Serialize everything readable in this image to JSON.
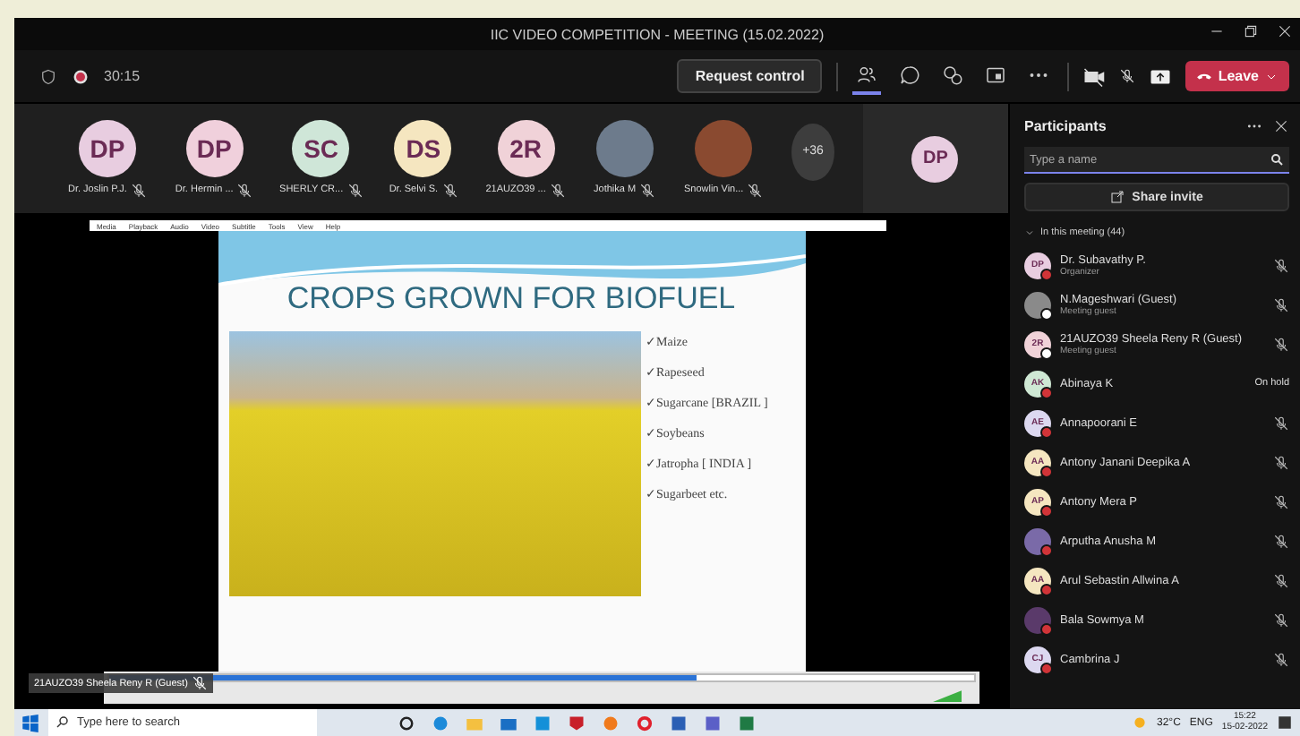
{
  "window": {
    "title": "IIC VIDEO COMPETITION - MEETING (15.02.2022)"
  },
  "toolbar": {
    "recording": true,
    "timer": "30:15",
    "request_button": "Request control",
    "leave_button": "Leave",
    "tools": [
      {
        "kind": "people",
        "selected": true
      },
      {
        "kind": "chat",
        "selected": false
      },
      {
        "kind": "reactions",
        "selected": false
      },
      {
        "kind": "rooms",
        "selected": false
      },
      {
        "kind": "more",
        "selected": false
      }
    ]
  },
  "strip": {
    "participants": [
      {
        "initials": "DP",
        "name": "Dr. Joslin P.J.",
        "color": "#e8cde0"
      },
      {
        "initials": "DP",
        "name": "Dr. Hermin ...",
        "color": "#f0d0dc"
      },
      {
        "initials": "SC",
        "name": "SHERLY CR...",
        "color": "#cfe6d8"
      },
      {
        "initials": "DS",
        "name": "Dr. Selvi S.",
        "color": "#f5e6c0"
      },
      {
        "initials": "2R",
        "name": "21AUZO39 ...",
        "color": "#f0d2d8"
      },
      {
        "name": "Jothika M",
        "color": "#6d7b8c"
      },
      {
        "name": "Snowlin Vin...",
        "color": "#8a4a30"
      }
    ],
    "overflow": "+36",
    "speaker_initials": "DP"
  },
  "player": {
    "menu": [
      "Media",
      "Playback",
      "Audio",
      "Video",
      "Subtitle",
      "Tools",
      "View",
      "Help"
    ],
    "level": 0.68,
    "slide": {
      "title": "CROPS GROWN FOR BIOFUEL",
      "bullets": [
        "✓Maize",
        "✓Rapeseed",
        "✓Sugarcane [BRAZIL ]",
        "✓Soybeans",
        "✓Jatropha [ INDIA ]",
        "✓Sugarbeet  etc."
      ]
    },
    "sharer": "21AUZO39 Sheela Reny R (Guest)"
  },
  "panel": {
    "title": "Participants",
    "search": {
      "placeholder": "Type a name"
    },
    "invite_button": "Share invite",
    "section": {
      "label": "In this meeting (44)",
      "expanded": true
    },
    "people": [
      {
        "initials": "DP",
        "name": "Dr. Subavathy P.",
        "role": "Organizer",
        "muted": true,
        "color": "#e8cde0",
        "presence": {
          "color": "#d13438"
        }
      },
      {
        "name": "N.Mageshwari (Guest)",
        "role": "Meeting guest",
        "muted": true,
        "color": "#8a8a8a",
        "presence": {
          "color": "#ffffff"
        }
      },
      {
        "initials": "2R",
        "name": "21AUZO39 Sheela Reny R (Guest)",
        "role": "Meeting guest",
        "muted": true,
        "color": "#f0d2d8",
        "presence": {
          "color": "#ffffff"
        }
      },
      {
        "initials": "AK",
        "name": "Abinaya K",
        "status": "On hold",
        "muted": false,
        "color": "#cfe8d4",
        "presence": {
          "color": "#d13438"
        }
      },
      {
        "initials": "AE",
        "name": "Annapoorani E",
        "muted": true,
        "color": "#dcd8f0",
        "presence": {
          "color": "#d13438"
        }
      },
      {
        "initials": "AA",
        "name": "Antony Janani Deepika A",
        "muted": true,
        "color": "#f5e6c0",
        "presence": {
          "color": "#d13438"
        }
      },
      {
        "initials": "AP",
        "name": "Antony Mera P",
        "muted": true,
        "color": "#f5e6c0",
        "presence": {
          "color": "#d13438"
        }
      },
      {
        "name": "Arputha Anusha M",
        "muted": true,
        "color": "#7a6aa8",
        "presence": {
          "color": "#d13438"
        }
      },
      {
        "initials": "AA",
        "name": "Arul Sebastin Allwina A",
        "muted": true,
        "color": "#f5e6c0",
        "presence": {
          "color": "#d13438"
        }
      },
      {
        "name": "Bala Sowmya M",
        "muted": true,
        "color": "#5a3a6a",
        "presence": {
          "color": "#d13438"
        }
      },
      {
        "initials": "CJ",
        "name": "Cambrina J",
        "muted": true,
        "color": "#dcd8f0",
        "presence": {
          "color": "#d13438"
        }
      }
    ]
  },
  "taskbar": {
    "search": {
      "placeholder": "Type here to search"
    },
    "weather": "32°C",
    "language": "ENG",
    "time": "15:22",
    "date": "15-02-2022"
  }
}
